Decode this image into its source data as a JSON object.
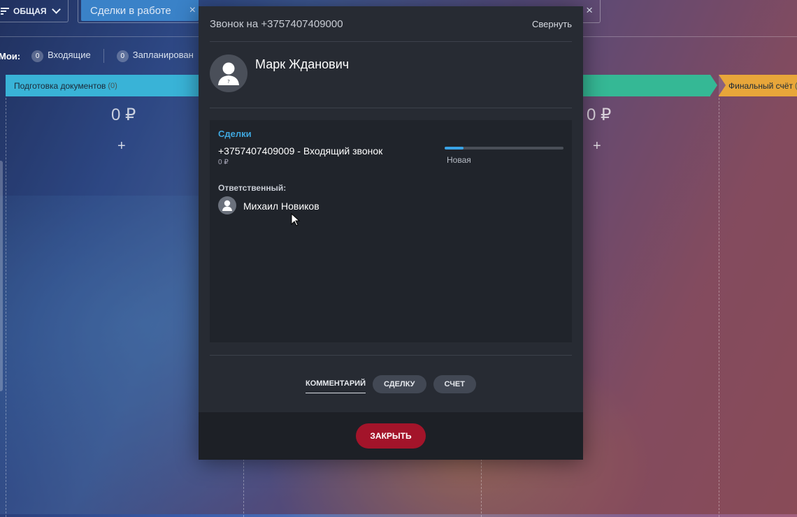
{
  "toolbar": {
    "filter_label": "ОБЩАЯ",
    "search_tag": "Сделки в работе",
    "tag_close": "×",
    "search_close": "×"
  },
  "counters": {
    "prefix": "Мои:",
    "incoming_count": "0",
    "incoming_label": "Входящие",
    "planned_count": "0",
    "planned_label": "Запланирован"
  },
  "stages": [
    {
      "label": "Подготовка документов",
      "count": "(0)",
      "color": "#39b3d7"
    },
    {
      "label": "",
      "count": "",
      "color": "#35b895"
    },
    {
      "label": "Финальный счёт",
      "count": "(",
      "color": "#e8a63a"
    }
  ],
  "columns": [
    {
      "sum": "0 ₽",
      "add": "+"
    },
    {
      "sum": "0 ₽",
      "add": "+"
    }
  ],
  "modal": {
    "title": "Звонок на +3757407409000",
    "collapse_label": "Свернуть",
    "contact_name": "Марк Жданович",
    "section_label": "Сделки",
    "deal_title": "+3757407409009 - Входящий звонок",
    "deal_amount": "0 ₽",
    "deal_stage": "Новая",
    "deal_progress": 0.16,
    "responsible_label": "Ответственный:",
    "responsible_name": "Михаил Новиков",
    "actions": {
      "comment": "КОММЕНТАРИЙ",
      "deal": "СДЕЛКУ",
      "invoice": "СЧЕТ"
    },
    "close_label": "ЗАКРЫТЬ"
  },
  "colors": {
    "accent": "#3fa7df",
    "close_button": "#a3142a",
    "modal_bg": "#272b33"
  }
}
